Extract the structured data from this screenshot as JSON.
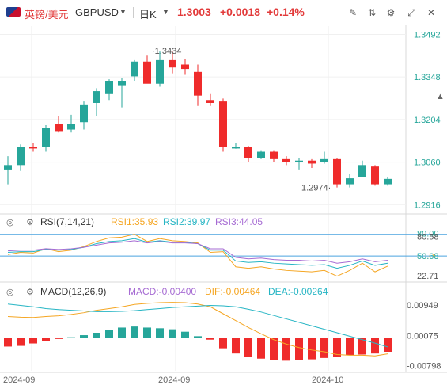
{
  "header": {
    "symbol_cn": "英镑/美元",
    "symbol_en": "GBPUSD",
    "timeframe": "日K",
    "price": "1.3003",
    "change": "+0.0018",
    "change_pct": "+0.14%",
    "tools": [
      "draw-icon",
      "indicator-icon",
      "settings-icon",
      "fullscreen-icon",
      "close-icon"
    ]
  },
  "colors": {
    "up": "#26a69a",
    "down": "#ef2b2b",
    "price_label": "#26a69a",
    "rsi1": "#f5a623",
    "rsi2": "#26b5c4",
    "rsi3": "#a66bd3",
    "dif": "#f5a623",
    "dea": "#26b5c4"
  },
  "chart_data": [
    {
      "type": "candlestick",
      "title": "",
      "y_ticks": [
        "1.3492",
        "1.3348",
        "1.3204",
        "1.3060",
        "1.2916"
      ],
      "ylim": [
        1.289,
        1.352
      ],
      "high_label": "1.3434",
      "low_label": "1.2974",
      "candles": [
        {
          "o": 1.3035,
          "h": 1.308,
          "l": 1.2985,
          "c": 1.305
        },
        {
          "o": 1.305,
          "h": 1.312,
          "l": 1.303,
          "c": 1.311
        },
        {
          "o": 1.311,
          "h": 1.3125,
          "l": 1.3095,
          "c": 1.3108
        },
        {
          "o": 1.311,
          "h": 1.3185,
          "l": 1.3095,
          "c": 1.3175
        },
        {
          "o": 1.319,
          "h": 1.3215,
          "l": 1.316,
          "c": 1.3165
        },
        {
          "o": 1.317,
          "h": 1.322,
          "l": 1.316,
          "c": 1.319
        },
        {
          "o": 1.3195,
          "h": 1.3265,
          "l": 1.317,
          "c": 1.3255
        },
        {
          "o": 1.326,
          "h": 1.331,
          "l": 1.3215,
          "c": 1.33
        },
        {
          "o": 1.329,
          "h": 1.334,
          "l": 1.327,
          "c": 1.3335
        },
        {
          "o": 1.332,
          "h": 1.3345,
          "l": 1.3245,
          "c": 1.3335
        },
        {
          "o": 1.335,
          "h": 1.3405,
          "l": 1.3335,
          "c": 1.34
        },
        {
          "o": 1.34,
          "h": 1.342,
          "l": 1.3335,
          "c": 1.3325
        },
        {
          "o": 1.3325,
          "h": 1.3434,
          "l": 1.3315,
          "c": 1.3405
        },
        {
          "o": 1.3405,
          "h": 1.3434,
          "l": 1.336,
          "c": 1.338
        },
        {
          "o": 1.339,
          "h": 1.341,
          "l": 1.3355,
          "c": 1.3375
        },
        {
          "o": 1.3365,
          "h": 1.339,
          "l": 1.325,
          "c": 1.3285
        },
        {
          "o": 1.327,
          "h": 1.329,
          "l": 1.325,
          "c": 1.326
        },
        {
          "o": 1.3265,
          "h": 1.3275,
          "l": 1.3095,
          "c": 1.311
        },
        {
          "o": 1.311,
          "h": 1.3125,
          "l": 1.3105,
          "c": 1.311
        },
        {
          "o": 1.311,
          "h": 1.3115,
          "l": 1.306,
          "c": 1.3075
        },
        {
          "o": 1.3075,
          "h": 1.31,
          "l": 1.307,
          "c": 1.3095
        },
        {
          "o": 1.3095,
          "h": 1.31,
          "l": 1.306,
          "c": 1.307
        },
        {
          "o": 1.307,
          "h": 1.308,
          "l": 1.305,
          "c": 1.306
        },
        {
          "o": 1.306,
          "h": 1.3075,
          "l": 1.3035,
          "c": 1.3065
        },
        {
          "o": 1.3065,
          "h": 1.307,
          "l": 1.304,
          "c": 1.3055
        },
        {
          "o": 1.306,
          "h": 1.3095,
          "l": 1.3055,
          "c": 1.307
        },
        {
          "o": 1.307,
          "h": 1.3075,
          "l": 1.2974,
          "c": 1.2985
        },
        {
          "o": 1.2985,
          "h": 1.302,
          "l": 1.2974,
          "c": 1.3005
        },
        {
          "o": 1.301,
          "h": 1.3065,
          "l": 1.301,
          "c": 1.305
        },
        {
          "o": 1.3045,
          "h": 1.305,
          "l": 1.298,
          "c": 1.2985
        },
        {
          "o": 1.2985,
          "h": 1.301,
          "l": 1.298,
          "c": 1.3003
        }
      ]
    },
    {
      "type": "line",
      "title": "RSI(7,14,21)",
      "legend": [
        "RSI1:35.93",
        "RSI2:39.97",
        "RSI3:44.05"
      ],
      "y_ticks": [
        "80.00",
        "80.58",
        "50.00",
        "50.68",
        "22.71"
      ],
      "ylim": [
        15,
        95
      ],
      "lines": [
        80,
        50
      ],
      "series": [
        {
          "name": "RSI1",
          "values": [
            52,
            55,
            54,
            60,
            56,
            58,
            63,
            70,
            75,
            76,
            80,
            70,
            74,
            71,
            70,
            68,
            55,
            56,
            35,
            33,
            35,
            32,
            30,
            29,
            28,
            30,
            22,
            30,
            40,
            28,
            35.93
          ]
        },
        {
          "name": "RSI2",
          "values": [
            55,
            56,
            56,
            59,
            58,
            59,
            62,
            67,
            70,
            71,
            74,
            69,
            71,
            69,
            69,
            67,
            58,
            58,
            43,
            41,
            42,
            40,
            39,
            38,
            37,
            38,
            33,
            37,
            43,
            37,
            39.97
          ]
        },
        {
          "name": "RSI3",
          "values": [
            57,
            58,
            58,
            60,
            59,
            60,
            62,
            65,
            68,
            69,
            71,
            68,
            70,
            68,
            68,
            67,
            60,
            60,
            48,
            46,
            47,
            45,
            44,
            44,
            43,
            44,
            40,
            42,
            46,
            42,
            44.05
          ]
        }
      ]
    },
    {
      "type": "bar",
      "title": "MACD(12,26,9)",
      "legend": [
        "MACD:-0.00400",
        "DIF:-0.00464",
        "DEA:-0.00264"
      ],
      "y_ticks": [
        "0.00949",
        "0.00075",
        "-0.00798"
      ],
      "ylim": [
        -0.0095,
        0.0125
      ],
      "histogram": [
        -0.0025,
        -0.0023,
        -0.0016,
        -0.0008,
        -0.0003,
        0.0002,
        0.0008,
        0.0015,
        0.0022,
        0.003,
        0.0033,
        0.003,
        0.0028,
        0.0025,
        0.0018,
        0.0005,
        -0.0005,
        -0.003,
        -0.0045,
        -0.0055,
        -0.006,
        -0.0064,
        -0.0066,
        -0.0065,
        -0.0062,
        -0.0058,
        -0.0055,
        -0.005,
        -0.0048,
        -0.0045,
        -0.004
      ],
      "dif": [
        0.0062,
        0.006,
        0.0059,
        0.0062,
        0.0064,
        0.0068,
        0.0073,
        0.008,
        0.0085,
        0.009,
        0.0097,
        0.01,
        0.0102,
        0.0103,
        0.0102,
        0.0098,
        0.009,
        0.007,
        0.005,
        0.003,
        0.0012,
        -0.0005,
        -0.0018,
        -0.0028,
        -0.0035,
        -0.004,
        -0.0048,
        -0.005,
        -0.005,
        -0.0052,
        -0.0046
      ],
      "dea": [
        0.0098,
        0.0094,
        0.009,
        0.0085,
        0.0082,
        0.008,
        0.0078,
        0.0076,
        0.0076,
        0.0077,
        0.0079,
        0.0082,
        0.0085,
        0.0088,
        0.009,
        0.0092,
        0.0094,
        0.0093,
        0.009,
        0.0083,
        0.0075,
        0.0065,
        0.0055,
        0.0045,
        0.0035,
        0.0025,
        0.0015,
        0.0005,
        -0.0005,
        -0.0015,
        -0.0026
      ]
    }
  ],
  "x_axis": {
    "labels": [
      "2024-09",
      "2024-09",
      "2024-10"
    ]
  }
}
